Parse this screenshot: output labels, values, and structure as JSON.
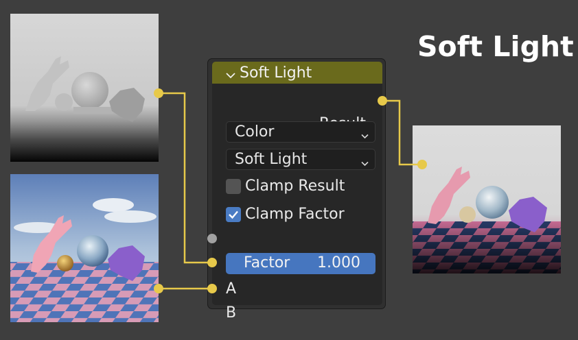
{
  "page_title": "Soft Light",
  "node": {
    "title": "Soft Light",
    "output_label": "Result",
    "color_mode": "Color",
    "blend_type": "Soft Light",
    "clamp_result_label": "Clamp Result",
    "clamp_result_checked": false,
    "clamp_factor_label": "Clamp Factor",
    "clamp_factor_checked": true,
    "factor_label": "Factor",
    "factor_value": "1.000",
    "input_a_label": "A",
    "input_b_label": "B"
  },
  "colors": {
    "background": "#3e3e3e",
    "header": "#6a6a1c",
    "socket": "#e7c94a",
    "wire": "#e7c94a",
    "factor_field": "#4676bf",
    "factor_socket": "#a1a1a1"
  },
  "icons": [
    "chevron-down-icon",
    "dropdown-arrow-icon",
    "checkmark-icon"
  ]
}
